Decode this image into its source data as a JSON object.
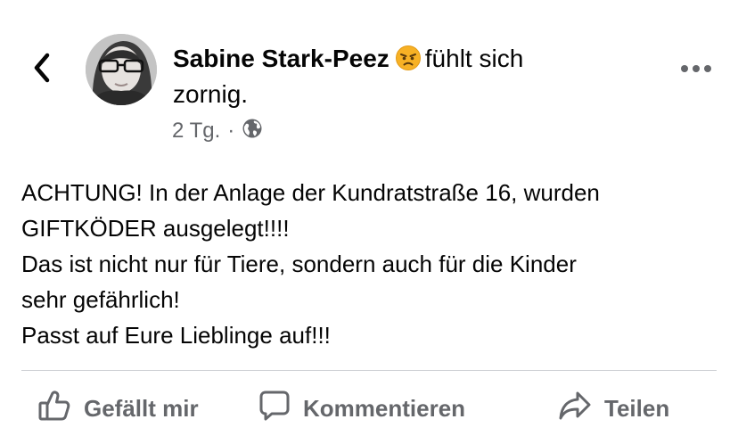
{
  "header": {
    "back_icon": "chevron-left-icon",
    "author_name": "Sabine Stark-Peez",
    "feeling_emoji": "angry-face-emoji",
    "feeling_text": "fühlt sich",
    "feeling_word": "zornig.",
    "timestamp": "2 Tg.",
    "separator": "·",
    "privacy_icon": "globe-icon",
    "more_icon": "more-options-icon"
  },
  "post": {
    "lines": [
      "ACHTUNG! In der Anlage der Kundratstraße 16, wurden",
      "GIFTKÖDER ausgelegt!!!!",
      "Das ist nicht nur für Tiere, sondern auch für die Kinder",
      "sehr gefährlich!",
      "Passt auf Eure Lieblinge auf!!!"
    ]
  },
  "actions": {
    "like_label": "Gefällt mir",
    "comment_label": "Kommentieren",
    "share_label": "Teilen"
  },
  "colors": {
    "text_primary": "#050505",
    "text_secondary": "#65676b",
    "divider": "#ced0d4",
    "emoji_face": "#f7b125"
  }
}
